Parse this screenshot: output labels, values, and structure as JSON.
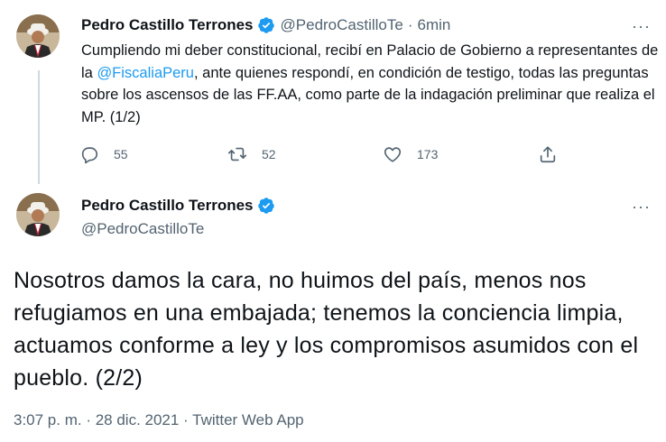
{
  "tweet1": {
    "name": "Pedro Castillo Terrones",
    "handle": "@PedroCastilloTe",
    "separator": "·",
    "time": "6min",
    "text_before": "Cumpliendo mi deber constitucional, recibí en Palacio de Gobierno a representantes de la ",
    "mention": "@FiscaliaPeru",
    "text_after": ", ante quienes respondí, en condición de testigo, todas las preguntas sobre los ascensos de las FF.AA, como parte de la indagación preliminar que realiza el MP. (1/2)",
    "replies": "55",
    "retweets": "52",
    "likes": "173"
  },
  "tweet2": {
    "name": "Pedro Castillo Terrones",
    "handle": "@PedroCastilloTe",
    "text": "Nosotros damos la cara, no huimos del país, menos nos refugiamos en una embajada; tenemos la conciencia limpia, actuamos conforme a ley y los compromisos asumidos con el pueblo. (2/2)",
    "timestamp": "3:07 p. m. · 28 dic. 2021 · Twitter Web App"
  },
  "more_glyph": "···",
  "colors": {
    "accent": "#1d9bf0",
    "secondary_text": "#536471",
    "text": "#0f1419"
  }
}
